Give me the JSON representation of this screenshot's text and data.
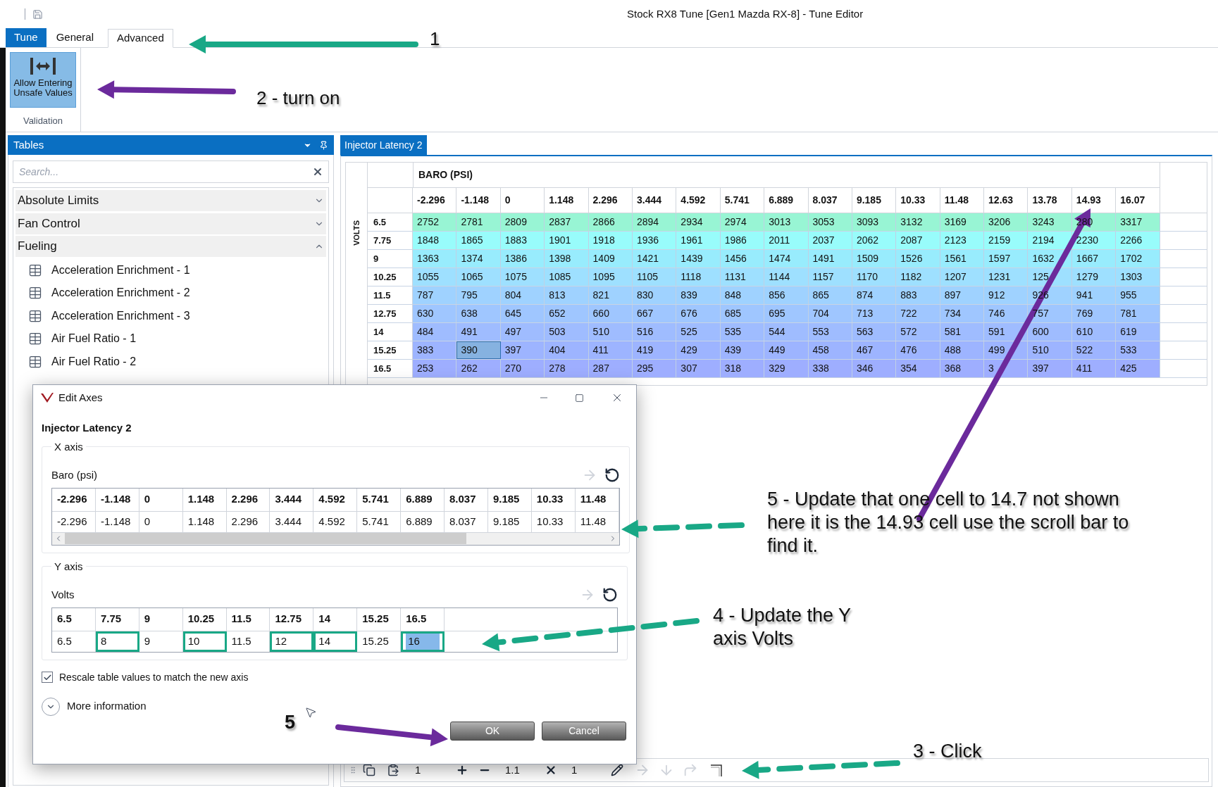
{
  "window": {
    "title": "Stock RX8 Tune [Gen1 Mazda RX-8] - Tune Editor"
  },
  "ribbon": {
    "tabs": [
      {
        "label": "Tune",
        "kind": "app",
        "selected": false
      },
      {
        "label": "General",
        "kind": "tab",
        "selected": false
      },
      {
        "label": "Advanced",
        "kind": "tab",
        "selected": true
      }
    ],
    "button": {
      "label": "Allow Entering Unsafe Values",
      "on": true
    },
    "group_label": "Validation"
  },
  "tables_panel": {
    "title": "Tables",
    "search": {
      "placeholder": "Search..."
    },
    "groups": [
      {
        "label": "Absolute Limits",
        "expanded": false
      },
      {
        "label": "Fan Control",
        "expanded": false
      },
      {
        "label": "Fueling",
        "expanded": true,
        "children": [
          {
            "label": "Acceleration Enrichment - 1"
          },
          {
            "label": "Acceleration Enrichment - 2"
          },
          {
            "label": "Acceleration Enrichment - 3"
          },
          {
            "label": "Air Fuel Ratio - 1"
          },
          {
            "label": "Air Fuel Ratio - 2"
          }
        ]
      }
    ]
  },
  "editor": {
    "tab": "Injector Latency 2",
    "x_axis_title": "BARO (PSI)",
    "y_axis_title": "VOLTS",
    "columns": [
      "-2.296",
      "-1.148",
      "0",
      "1.148",
      "2.296",
      "3.444",
      "4.592",
      "5.741",
      "6.889",
      "8.037",
      "9.185",
      "10.33",
      "11.48",
      "12.63",
      "13.78",
      "14.93",
      "16.07"
    ],
    "rows": [
      {
        "label": "6.5",
        "cells": [
          {
            "value": "2752",
            "selected": false
          },
          {
            "value": "2781",
            "selected": false
          },
          {
            "value": "2809",
            "selected": false
          },
          {
            "value": "2837",
            "selected": false
          },
          {
            "value": "2866",
            "selected": false
          },
          {
            "value": "2894",
            "selected": false
          },
          {
            "value": "2934",
            "selected": false
          },
          {
            "value": "2974",
            "selected": false
          },
          {
            "value": "3013",
            "selected": false
          },
          {
            "value": "3053",
            "selected": false
          },
          {
            "value": "3093",
            "selected": false
          },
          {
            "value": "3132",
            "selected": false
          },
          {
            "value": "3169",
            "selected": false
          },
          {
            "value": "3206",
            "selected": false
          },
          {
            "value": "3243",
            "selected": false
          },
          {
            "value": "280",
            "selected": false
          },
          {
            "value": "3317",
            "selected": false
          }
        ]
      },
      {
        "label": "7.75",
        "cells": [
          {
            "value": "1848",
            "selected": false
          },
          {
            "value": "1865",
            "selected": false
          },
          {
            "value": "1883",
            "selected": false
          },
          {
            "value": "1901",
            "selected": false
          },
          {
            "value": "1918",
            "selected": false
          },
          {
            "value": "1936",
            "selected": false
          },
          {
            "value": "1961",
            "selected": false
          },
          {
            "value": "1986",
            "selected": false
          },
          {
            "value": "2011",
            "selected": false
          },
          {
            "value": "2037",
            "selected": false
          },
          {
            "value": "2062",
            "selected": false
          },
          {
            "value": "2087",
            "selected": false
          },
          {
            "value": "2123",
            "selected": false
          },
          {
            "value": "2159",
            "selected": false
          },
          {
            "value": "2194",
            "selected": false
          },
          {
            "value": "2230",
            "selected": false
          },
          {
            "value": "2266",
            "selected": false
          }
        ]
      },
      {
        "label": "9",
        "cells": [
          {
            "value": "1363",
            "selected": false
          },
          {
            "value": "1374",
            "selected": false
          },
          {
            "value": "1386",
            "selected": false
          },
          {
            "value": "1398",
            "selected": false
          },
          {
            "value": "1409",
            "selected": false
          },
          {
            "value": "1421",
            "selected": false
          },
          {
            "value": "1439",
            "selected": false
          },
          {
            "value": "1456",
            "selected": false
          },
          {
            "value": "1474",
            "selected": false
          },
          {
            "value": "1491",
            "selected": false
          },
          {
            "value": "1509",
            "selected": false
          },
          {
            "value": "1526",
            "selected": false
          },
          {
            "value": "1561",
            "selected": false
          },
          {
            "value": "1597",
            "selected": false
          },
          {
            "value": "1632",
            "selected": false
          },
          {
            "value": "1667",
            "selected": false
          },
          {
            "value": "1702",
            "selected": false
          }
        ]
      },
      {
        "label": "10.25",
        "cells": [
          {
            "value": "1055",
            "selected": false
          },
          {
            "value": "1065",
            "selected": false
          },
          {
            "value": "1075",
            "selected": false
          },
          {
            "value": "1085",
            "selected": false
          },
          {
            "value": "1095",
            "selected": false
          },
          {
            "value": "1105",
            "selected": false
          },
          {
            "value": "1118",
            "selected": false
          },
          {
            "value": "1131",
            "selected": false
          },
          {
            "value": "1144",
            "selected": false
          },
          {
            "value": "1157",
            "selected": false
          },
          {
            "value": "1170",
            "selected": false
          },
          {
            "value": "1182",
            "selected": false
          },
          {
            "value": "1207",
            "selected": false
          },
          {
            "value": "1231",
            "selected": false
          },
          {
            "value": "125",
            "selected": false
          },
          {
            "value": "1279",
            "selected": false
          },
          {
            "value": "1303",
            "selected": false
          }
        ]
      },
      {
        "label": "11.5",
        "cells": [
          {
            "value": "787",
            "selected": false
          },
          {
            "value": "795",
            "selected": false
          },
          {
            "value": "804",
            "selected": false
          },
          {
            "value": "813",
            "selected": false
          },
          {
            "value": "821",
            "selected": false
          },
          {
            "value": "830",
            "selected": false
          },
          {
            "value": "839",
            "selected": false
          },
          {
            "value": "848",
            "selected": false
          },
          {
            "value": "856",
            "selected": false
          },
          {
            "value": "865",
            "selected": false
          },
          {
            "value": "874",
            "selected": false
          },
          {
            "value": "883",
            "selected": false
          },
          {
            "value": "897",
            "selected": false
          },
          {
            "value": "912",
            "selected": false
          },
          {
            "value": "926",
            "selected": false
          },
          {
            "value": "941",
            "selected": false
          },
          {
            "value": "955",
            "selected": false
          }
        ]
      },
      {
        "label": "12.75",
        "cells": [
          {
            "value": "630",
            "selected": false
          },
          {
            "value": "638",
            "selected": false
          },
          {
            "value": "645",
            "selected": false
          },
          {
            "value": "652",
            "selected": false
          },
          {
            "value": "660",
            "selected": false
          },
          {
            "value": "667",
            "selected": false
          },
          {
            "value": "676",
            "selected": false
          },
          {
            "value": "685",
            "selected": false
          },
          {
            "value": "695",
            "selected": false
          },
          {
            "value": "704",
            "selected": false
          },
          {
            "value": "713",
            "selected": false
          },
          {
            "value": "722",
            "selected": false
          },
          {
            "value": "734",
            "selected": false
          },
          {
            "value": "746",
            "selected": false
          },
          {
            "value": "757",
            "selected": false
          },
          {
            "value": "769",
            "selected": false
          },
          {
            "value": "781",
            "selected": false
          }
        ]
      },
      {
        "label": "14",
        "cells": [
          {
            "value": "484",
            "selected": false
          },
          {
            "value": "491",
            "selected": false
          },
          {
            "value": "497",
            "selected": false
          },
          {
            "value": "503",
            "selected": false
          },
          {
            "value": "510",
            "selected": false
          },
          {
            "value": "516",
            "selected": false
          },
          {
            "value": "525",
            "selected": false
          },
          {
            "value": "535",
            "selected": false
          },
          {
            "value": "544",
            "selected": false
          },
          {
            "value": "553",
            "selected": false
          },
          {
            "value": "563",
            "selected": false
          },
          {
            "value": "572",
            "selected": false
          },
          {
            "value": "581",
            "selected": false
          },
          {
            "value": "591",
            "selected": false
          },
          {
            "value": "600",
            "selected": false
          },
          {
            "value": "610",
            "selected": false
          },
          {
            "value": "619",
            "selected": false
          }
        ]
      },
      {
        "label": "15.25",
        "cells": [
          {
            "value": "383",
            "selected": false
          },
          {
            "value": "390",
            "selected": true
          },
          {
            "value": "397",
            "selected": false
          },
          {
            "value": "404",
            "selected": false
          },
          {
            "value": "411",
            "selected": false
          },
          {
            "value": "419",
            "selected": false
          },
          {
            "value": "429",
            "selected": false
          },
          {
            "value": "439",
            "selected": false
          },
          {
            "value": "449",
            "selected": false
          },
          {
            "value": "458",
            "selected": false
          },
          {
            "value": "467",
            "selected": false
          },
          {
            "value": "476",
            "selected": false
          },
          {
            "value": "488",
            "selected": false
          },
          {
            "value": "499",
            "selected": false
          },
          {
            "value": "510",
            "selected": false
          },
          {
            "value": "522",
            "selected": false
          },
          {
            "value": "533",
            "selected": false
          }
        ]
      },
      {
        "label": "16.5",
        "cells": [
          {
            "value": "253",
            "selected": false
          },
          {
            "value": "262",
            "selected": false
          },
          {
            "value": "270",
            "selected": false
          },
          {
            "value": "278",
            "selected": false
          },
          {
            "value": "287",
            "selected": false
          },
          {
            "value": "295",
            "selected": false
          },
          {
            "value": "307",
            "selected": false
          },
          {
            "value": "318",
            "selected": false
          },
          {
            "value": "329",
            "selected": false
          },
          {
            "value": "338",
            "selected": false
          },
          {
            "value": "346",
            "selected": false
          },
          {
            "value": "354",
            "selected": false
          },
          {
            "value": "368",
            "selected": false
          },
          {
            "value": "3",
            "selected": false
          },
          {
            "value": "397",
            "selected": false
          },
          {
            "value": "411",
            "selected": false
          },
          {
            "value": "425",
            "selected": false
          }
        ]
      }
    ]
  },
  "toolbar": {
    "inputs": [
      "1",
      "1.1",
      "1"
    ]
  },
  "dialog": {
    "title": "Edit Axes",
    "table_name": "Injector Latency 2",
    "x_axis": {
      "legend": "X axis",
      "label": "Baro (psi)",
      "headers": [
        "-2.296",
        "-1.148",
        "0",
        "1.148",
        "2.296",
        "3.444",
        "4.592",
        "5.741",
        "6.889",
        "8.037",
        "9.185",
        "10.33",
        "11.48"
      ],
      "values": [
        {
          "value": "-2.296",
          "highlighted": false,
          "selected": false
        },
        {
          "value": "-1.148",
          "highlighted": false,
          "selected": false
        },
        {
          "value": "0",
          "highlighted": false,
          "selected": false
        },
        {
          "value": "1.148",
          "highlighted": false,
          "selected": false
        },
        {
          "value": "2.296",
          "highlighted": false,
          "selected": false
        },
        {
          "value": "3.444",
          "highlighted": false,
          "selected": false
        },
        {
          "value": "4.592",
          "highlighted": false,
          "selected": false
        },
        {
          "value": "5.741",
          "highlighted": false,
          "selected": false
        },
        {
          "value": "6.889",
          "highlighted": false,
          "selected": false
        },
        {
          "value": "8.037",
          "highlighted": false,
          "selected": false
        },
        {
          "value": "9.185",
          "highlighted": false,
          "selected": false
        },
        {
          "value": "10.33",
          "highlighted": false,
          "selected": false
        },
        {
          "value": "11.48",
          "highlighted": false,
          "selected": false
        }
      ]
    },
    "y_axis": {
      "legend": "Y axis",
      "label": "Volts",
      "headers": [
        "6.5",
        "7.75",
        "9",
        "10.25",
        "11.5",
        "12.75",
        "14",
        "15.25",
        "16.5"
      ],
      "values": [
        {
          "value": "6.5",
          "highlighted": false,
          "selected": false
        },
        {
          "value": "8",
          "highlighted": true,
          "selected": false
        },
        {
          "value": "9",
          "highlighted": false,
          "selected": false
        },
        {
          "value": "10",
          "highlighted": true,
          "selected": false
        },
        {
          "value": "11.5",
          "highlighted": false,
          "selected": false
        },
        {
          "value": "12",
          "highlighted": true,
          "selected": false
        },
        {
          "value": "14",
          "highlighted": true,
          "selected": false
        },
        {
          "value": "15.25",
          "highlighted": false,
          "selected": false
        },
        {
          "value": "16",
          "highlighted": true,
          "selected": true
        }
      ]
    },
    "rescale": {
      "label": "Rescale table values to match the new axis",
      "checked": true
    },
    "more_info": {
      "label": "More information",
      "expanded": false
    },
    "buttons": [
      "OK",
      "Cancel"
    ]
  },
  "annotations": [
    {
      "text": "1"
    },
    {
      "text": "2 - turn on"
    },
    {
      "text": "5 - Update that one cell to 14.7 not shown here it is the 14.93 cell use the scroll bar to find it."
    },
    {
      "text": "4 - Update the Y axis Volts"
    },
    {
      "text": "5"
    },
    {
      "text": "3 - Click"
    }
  ],
  "arrows": [
    {
      "color": "#19a886",
      "kind": "solid"
    },
    {
      "color": "#6b2a9c",
      "kind": "solid"
    },
    {
      "color": "#6b2a9c",
      "kind": "solid"
    },
    {
      "color": "#19a886",
      "kind": "dashed"
    },
    {
      "color": "#19a886",
      "kind": "dashed"
    },
    {
      "color": "#6b2a9c",
      "kind": "solid"
    },
    {
      "color": "#19a886",
      "kind": "dashed"
    }
  ]
}
